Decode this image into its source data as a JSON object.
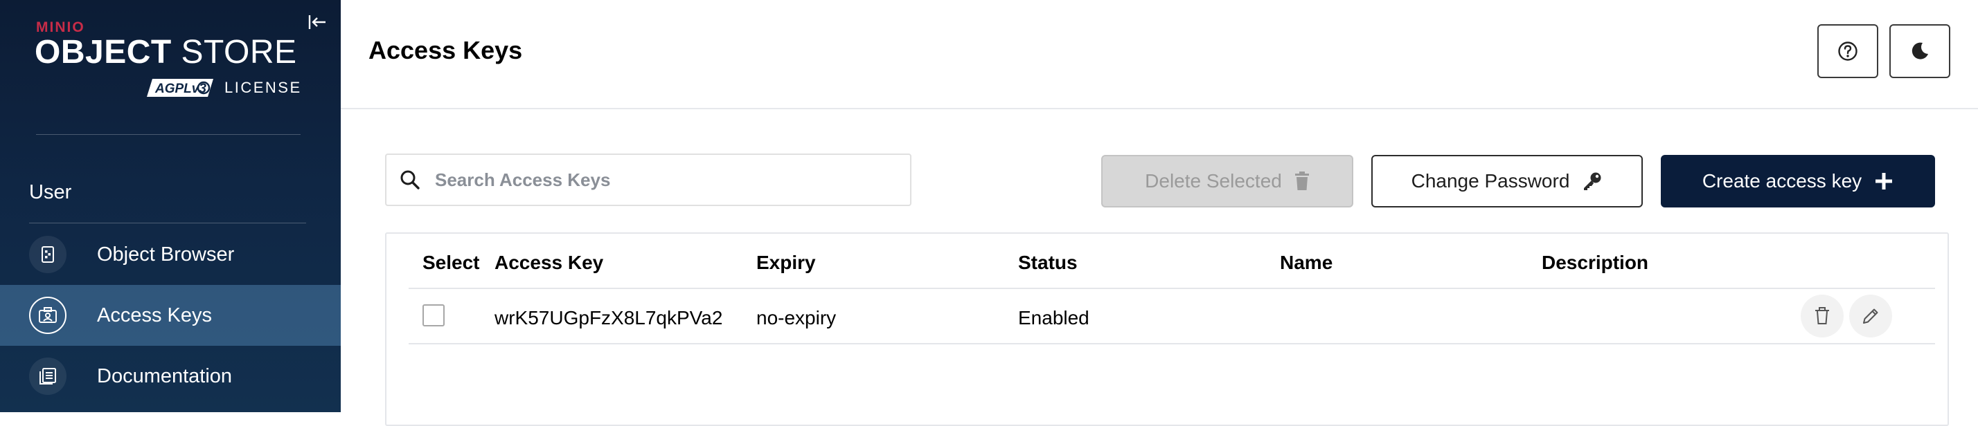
{
  "sidebar": {
    "logo": {
      "brand": "MINIO",
      "product_bold": "OBJECT",
      "product_light": " STORE",
      "badge": "AGPLv3",
      "license": "LICENSE"
    },
    "section_title": "User",
    "items": [
      {
        "label": "Object Browser",
        "icon": "object-browser-icon",
        "active": false
      },
      {
        "label": "Access Keys",
        "icon": "access-keys-icon",
        "active": true
      },
      {
        "label": "Documentation",
        "icon": "documentation-icon",
        "active": false
      }
    ]
  },
  "header": {
    "title": "Access Keys",
    "help_icon": "help-icon",
    "theme_icon": "dark-mode-icon"
  },
  "toolbar": {
    "search_placeholder": "Search Access Keys",
    "search_value": "",
    "delete_label": "Delete Selected",
    "change_password_label": "Change Password",
    "create_label": "Create access key"
  },
  "table": {
    "columns": [
      "Select",
      "Access Key",
      "Expiry",
      "Status",
      "Name",
      "Description"
    ],
    "rows": [
      {
        "access_key": "wrK57UGpFzX8L7qkPVa2",
        "expiry": "no-expiry",
        "status": "Enabled",
        "name": "",
        "description": "",
        "selected": false
      }
    ]
  },
  "colors": {
    "sidebar_bg": "#0f2644",
    "brand_red": "#c72c48",
    "primary_button": "#0a1d3b",
    "active_nav": "#4c7ca9"
  }
}
